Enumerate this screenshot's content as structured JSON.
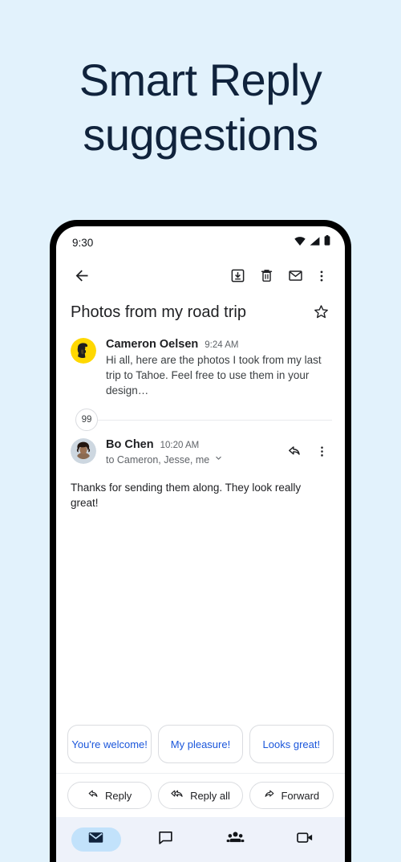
{
  "page": {
    "background_color": "#e2f2fc",
    "headline_line1": "Smart Reply",
    "headline_line2": "suggestions",
    "headline_color": "#10233c"
  },
  "phone": {
    "status_bar": {
      "time": "9:30",
      "icons": [
        "wifi-icon",
        "cellular-signal-icon",
        "battery-icon"
      ]
    },
    "toolbar": {
      "back_icon": "back-arrow-icon",
      "actions": [
        {
          "icon": "archive-icon",
          "name": "archive-button"
        },
        {
          "icon": "trash-icon",
          "name": "delete-button"
        },
        {
          "icon": "envelope-icon",
          "name": "mark-unread-button"
        },
        {
          "icon": "more-vert-icon",
          "name": "more-options-button"
        }
      ]
    },
    "subject": {
      "text": "Photos from my road trip",
      "star_icon": "star-outline-icon"
    },
    "messages": [
      {
        "sender": "Cameron Oelsen",
        "time": "9:24 AM",
        "snippet": "Hi all, here are the photos I took from my last trip to Tahoe. Feel free to use them in your design…",
        "avatar_color": "#ffd800"
      },
      {
        "sender": "Bo Chen",
        "time": "10:20 AM",
        "recipients": "to Cameron, Jesse, me",
        "expand_icon": "chevron-down-icon",
        "reply_icon": "reply-arrow-icon",
        "more_icon": "more-vert-icon",
        "body": "Thanks for sending them along. They look really great!",
        "avatar_color": "#b8c4d0"
      }
    ],
    "collapsed_count": "99",
    "smart_replies": {
      "text_color": "#1a56db",
      "items": [
        "You're welcome!",
        "My pleasure!",
        "Looks great!"
      ]
    },
    "reply_bar": [
      {
        "label": "Reply",
        "icon": "reply-arrow-icon"
      },
      {
        "label": "Reply all",
        "icon": "reply-all-arrow-icon"
      },
      {
        "label": "Forward",
        "icon": "forward-arrow-icon"
      }
    ],
    "bottom_nav": {
      "active_pill_color": "#c2e2fb",
      "items": [
        {
          "icon": "mail-filled-icon",
          "name": "nav-mail",
          "active": true
        },
        {
          "icon": "chat-bubble-icon",
          "name": "nav-chat",
          "active": false
        },
        {
          "icon": "spaces-people-icon",
          "name": "nav-spaces",
          "active": false
        },
        {
          "icon": "video-camera-icon",
          "name": "nav-meet",
          "active": false
        }
      ]
    }
  }
}
